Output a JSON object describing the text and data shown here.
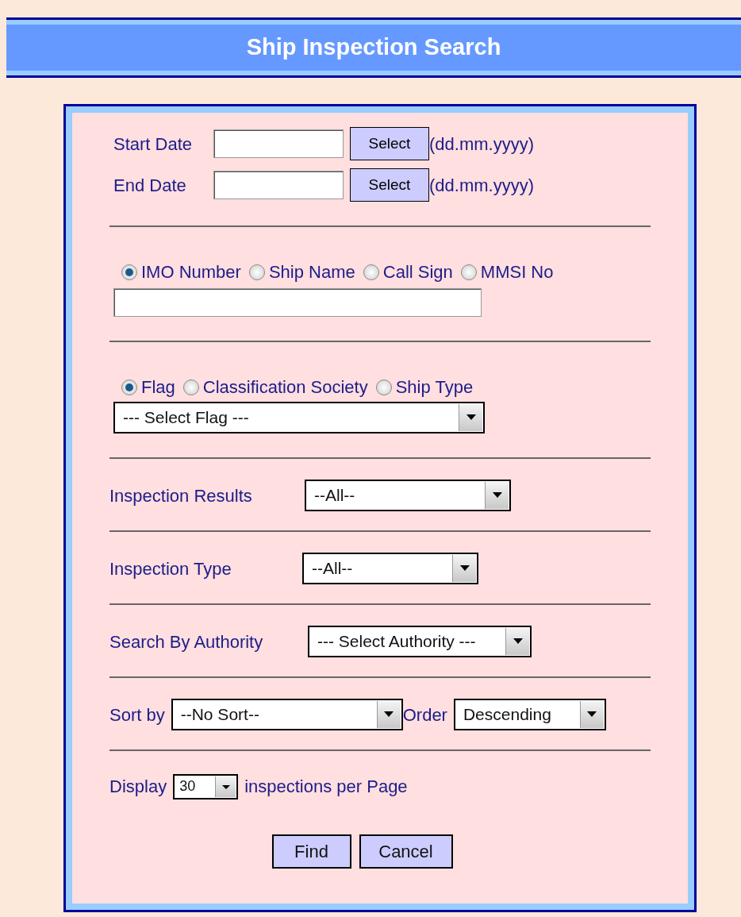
{
  "title": "Ship Inspection Search",
  "date_fields": [
    {
      "label": "Start Date",
      "button": "Select",
      "hint": "(dd.mm.yyyy)"
    },
    {
      "label": "End Date",
      "button": "Select",
      "hint": "(dd.mm.yyyy)"
    }
  ],
  "identifier": {
    "options": [
      {
        "label": "IMO Number",
        "selected": true
      },
      {
        "label": "Ship Name",
        "selected": false
      },
      {
        "label": "Call Sign",
        "selected": false
      },
      {
        "label": "MMSI No",
        "selected": false
      }
    ]
  },
  "category": {
    "options": [
      {
        "label": "Flag",
        "selected": true
      },
      {
        "label": "Classification Society",
        "selected": false
      },
      {
        "label": "Ship Type",
        "selected": false
      }
    ],
    "dropdown": "--- Select Flag ---"
  },
  "filters": [
    {
      "label": "Inspection Results",
      "value": "--All--"
    },
    {
      "label": "Inspection Type",
      "value": "--All--"
    },
    {
      "label": "Search By Authority",
      "value": "--- Select Authority ---"
    }
  ],
  "sort": {
    "label": "Sort by",
    "value": "--No Sort--",
    "order_label": "Order",
    "order_value": "Descending"
  },
  "display": {
    "label": "Display",
    "value": "30",
    "suffix": "inspections per Page"
  },
  "buttons": [
    "Find",
    "Cancel"
  ]
}
